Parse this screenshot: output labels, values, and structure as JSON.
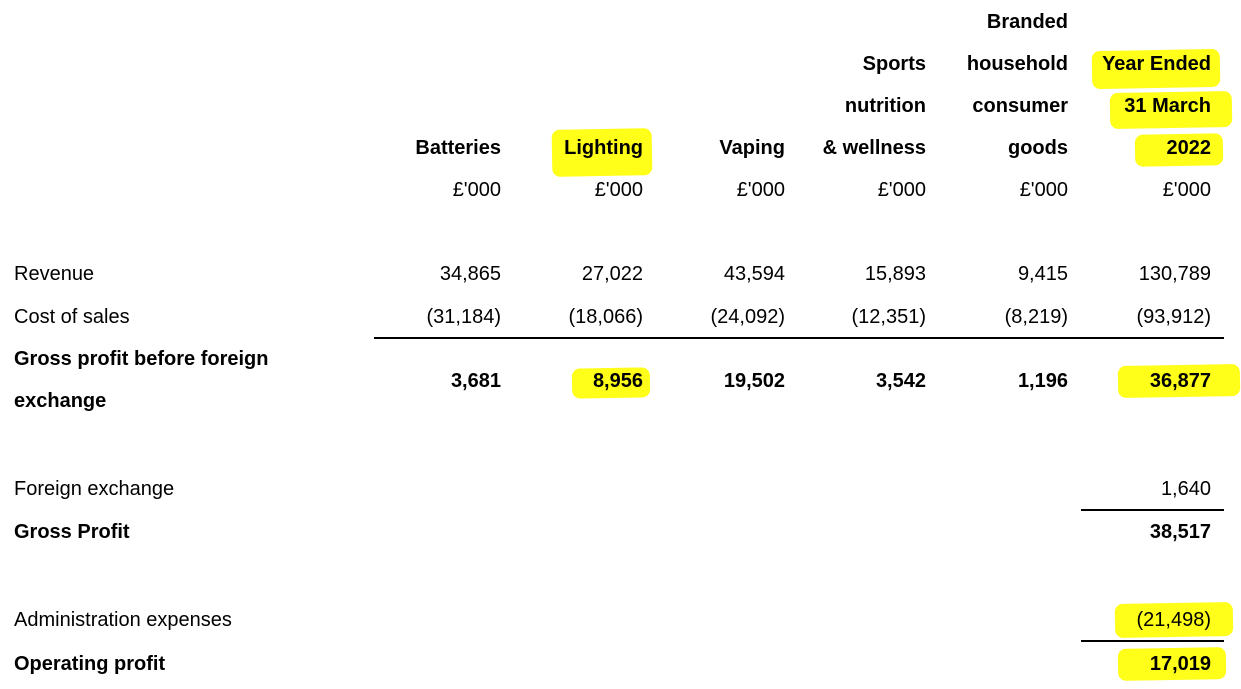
{
  "header": {
    "col1": [
      "Batteries"
    ],
    "col2": [
      "Lighting"
    ],
    "col3": [
      "Vaping"
    ],
    "col4": [
      "Sports",
      "nutrition",
      "& wellness"
    ],
    "col5": [
      "Branded",
      "household",
      "consumer",
      "goods"
    ],
    "col6": [
      "Year Ended",
      "31 March",
      "2022"
    ],
    "units": [
      "£'000",
      "£'000",
      "£'000",
      "£'000",
      "£'000",
      "£'000"
    ]
  },
  "rows": {
    "revenue": {
      "label": "Revenue",
      "values": [
        "34,865",
        "27,022",
        "43,594",
        "15,893",
        "9,415",
        "130,789"
      ]
    },
    "cost_of_sales": {
      "label": "Cost of sales",
      "values": [
        "(31,184)",
        "(18,066)",
        "(24,092)",
        "(12,351)",
        "(8,219)",
        "(93,912)"
      ]
    },
    "gross_profit_before_fx": {
      "label_line1": "Gross profit before foreign",
      "label_line2": "exchange",
      "values": [
        "3,681",
        "8,956",
        "19,502",
        "3,542",
        "1,196",
        "36,877"
      ]
    },
    "foreign_exchange": {
      "label": "Foreign exchange",
      "total": "1,640"
    },
    "gross_profit": {
      "label": "Gross Profit",
      "total": "38,517"
    },
    "administration_expenses": {
      "label": "Administration expenses",
      "total": "(21,498)"
    },
    "operating_profit": {
      "label": "Operating profit",
      "total": "17,019"
    }
  },
  "highlight_color": "#ffff1a"
}
